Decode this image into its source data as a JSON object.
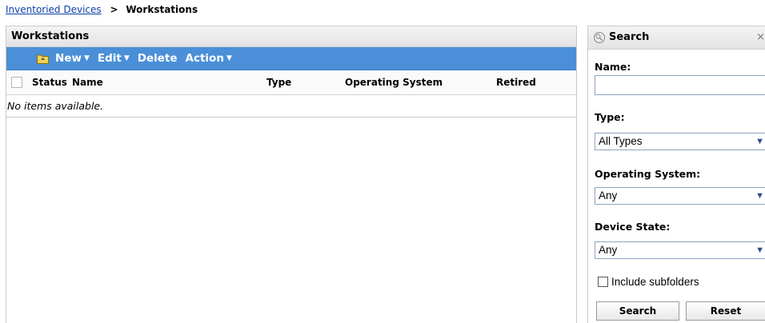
{
  "breadcrumb": {
    "parent": "Inventoried Devices",
    "separator": ">",
    "current": "Workstations"
  },
  "main": {
    "title": "Workstations",
    "toolbar": {
      "new_label": "New",
      "edit_label": "Edit",
      "delete_label": "Delete",
      "action_label": "Action"
    },
    "columns": [
      "Status",
      "Name",
      "Type",
      "Operating System",
      "Retired"
    ],
    "empty_message": "No items available."
  },
  "search": {
    "title": "Search",
    "close": "×",
    "name_label": "Name:",
    "name_value": "",
    "type_label": "Type:",
    "type_value": "All Types",
    "os_label": "Operating System:",
    "os_value": "Any",
    "state_label": "Device State:",
    "state_value": "Any",
    "include_label": "Include subfolders",
    "include_checked": false,
    "search_button": "Search",
    "reset_button": "Reset"
  },
  "colors": {
    "toolbar": "#4a8fd8",
    "link": "#0b3fa8"
  }
}
